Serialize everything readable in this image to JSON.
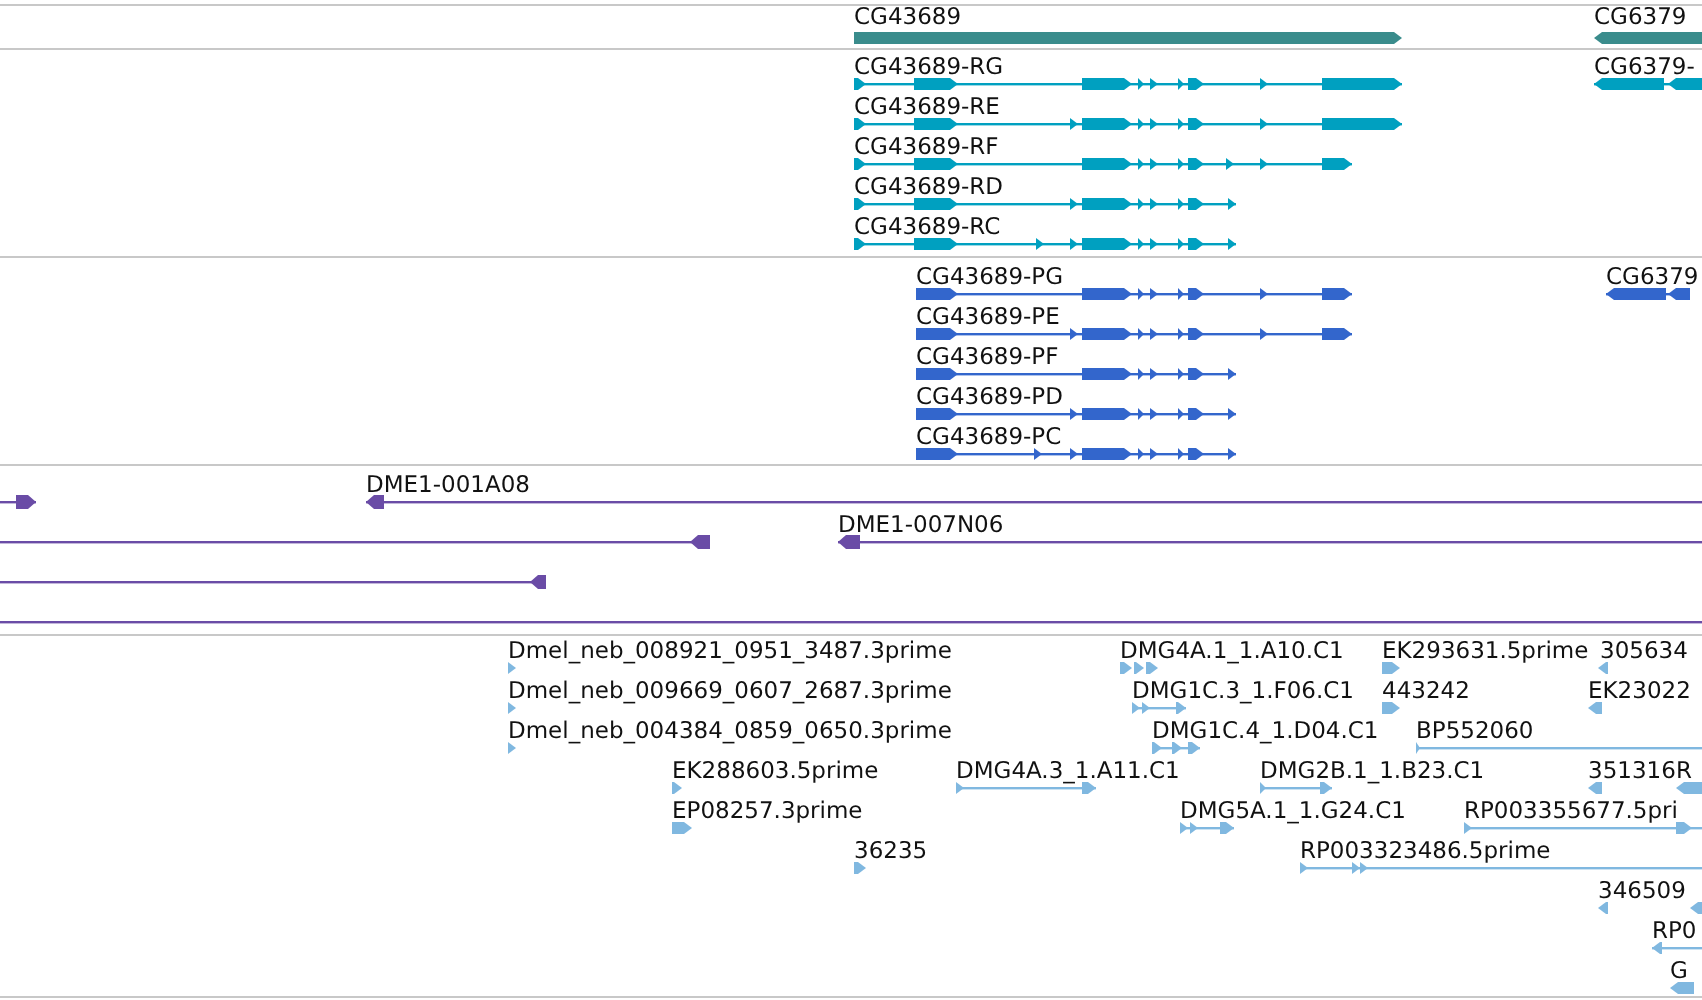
{
  "tracks": [
    {
      "kind": "gene",
      "features": [
        {
          "label": "CG43689",
          "reverse": false
        },
        {
          "label": "CG6379",
          "reverse": true
        }
      ]
    },
    {
      "kind": "transcript",
      "features": [
        {
          "label": "CG43689-RG",
          "reverse": false
        },
        {
          "label": "CG43689-RE",
          "reverse": false
        },
        {
          "label": "CG43689-RF",
          "reverse": false
        },
        {
          "label": "CG43689-RD",
          "reverse": false
        },
        {
          "label": "CG43689-RC",
          "reverse": false
        },
        {
          "label": "CG6379-",
          "reverse": true
        }
      ]
    },
    {
      "kind": "protein",
      "features": [
        {
          "label": "CG43689-PG",
          "reverse": false
        },
        {
          "label": "CG43689-PE",
          "reverse": false
        },
        {
          "label": "CG43689-PF",
          "reverse": false
        },
        {
          "label": "CG43689-PD",
          "reverse": false
        },
        {
          "label": "CG43689-PC",
          "reverse": false
        },
        {
          "label": "CG6379",
          "reverse": true
        }
      ]
    },
    {
      "kind": "clone",
      "features": [
        {
          "kind": "arrow",
          "reverse": false
        },
        {
          "kind": "arrow",
          "label": "DME1-001A08",
          "reverse": true
        },
        {
          "kind": "arrow",
          "reverse": true
        },
        {
          "kind": "arrow",
          "label": "DME1-007N06",
          "reverse": true
        },
        {
          "kind": "arrow",
          "reverse": true
        },
        {
          "kind": "line"
        }
      ]
    },
    {
      "kind": "est",
      "features": [
        {
          "label": "Dmel_neb_008921_0951_3487.3prime",
          "reverse": false
        },
        {
          "label": "DMG4A.1_1.A10.C1",
          "reverse": false
        },
        {
          "label": "EK293631.5prime",
          "reverse": false
        },
        {
          "label": "305634",
          "reverse": true
        },
        {
          "label": "Dmel_neb_009669_0607_2687.3prime",
          "reverse": false
        },
        {
          "label": "DMG1C.3_1.F06.C1",
          "reverse": false
        },
        {
          "label": "443242",
          "reverse": false
        },
        {
          "label": "EK23022",
          "reverse": true
        },
        {
          "label": "Dmel_neb_004384_0859_0650.3prime",
          "reverse": false
        },
        {
          "label": "DMG1C.4_1.D04.C1",
          "reverse": false
        },
        {
          "label": "BP552060",
          "reverse": false
        },
        {
          "label": "EK288603.5prime",
          "reverse": false
        },
        {
          "label": "DMG4A.3_1.A11.C1",
          "reverse": false
        },
        {
          "label": "DMG2B.1_1.B23.C1",
          "reverse": false
        },
        {
          "label": "351316",
          "reverse": true
        },
        {
          "label": "R",
          "reverse": true
        },
        {
          "label": "EP08257.3prime",
          "reverse": false
        },
        {
          "label": "DMG5A.1_1.G24.C1",
          "reverse": false
        },
        {
          "label": "RP003355677.5pri",
          "reverse": false
        },
        {
          "label": "36235",
          "reverse": false
        },
        {
          "label": "RP003323486.5prime",
          "reverse": false
        },
        {
          "label": "346509",
          "reverse": true
        },
        {
          "label": "RP0",
          "reverse": true
        },
        {
          "label": "G",
          "reverse": true
        }
      ]
    }
  ]
}
